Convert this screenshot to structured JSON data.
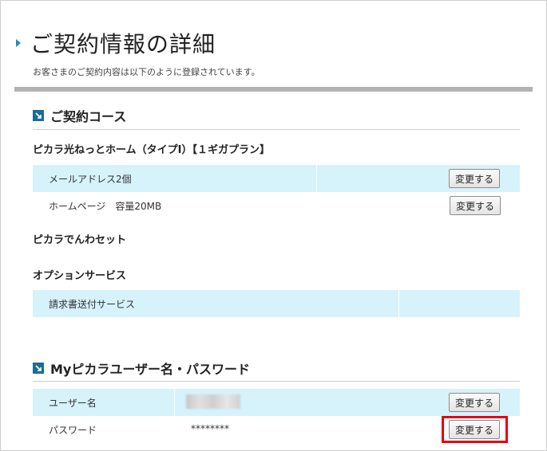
{
  "header": {
    "title": "ご契約情報の詳細",
    "subtitle": "お客さまのご契約内容は以下のように登録されています。"
  },
  "course": {
    "heading": "ご契約コース",
    "plan_name": "ピカラ光ねっとホーム（タイプⅠ）【１ギガプラン】",
    "items": [
      {
        "label": "メールアドレス2個",
        "button": "変更する"
      },
      {
        "label": "ホームページ　容量20MB",
        "button": "変更する"
      }
    ],
    "phone_set": "ピカラでんわセット",
    "option_heading": "オプションサービス",
    "options": [
      {
        "label": "請求書送付サービス"
      }
    ]
  },
  "account": {
    "heading": "Myピカラユーザー名・パスワード",
    "rows": [
      {
        "label": "ユーザー名",
        "value": "",
        "button": "変更する"
      },
      {
        "label": "パスワード",
        "value": "********",
        "button": "変更する"
      }
    ]
  },
  "colors": {
    "accent": "#1a6d96",
    "row_bg": "#d6f2fb",
    "highlight": "#e60012"
  }
}
